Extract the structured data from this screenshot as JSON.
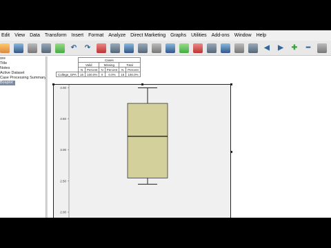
{
  "menu": [
    "Edit",
    "View",
    "Data",
    "Transform",
    "Insert",
    "Format",
    "Analyze",
    "Direct Marketing",
    "Graphs",
    "Utilities",
    "Add-ons",
    "Window",
    "Help"
  ],
  "toolbar_icons": [
    "open-icon",
    "save-icon",
    "print-icon",
    "dialog-recall-icon",
    "refresh-icon",
    "undo-icon",
    "redo-icon",
    "goto-data-icon",
    "goto-case-icon",
    "goto-variable-icon",
    "variables-icon",
    "find-icon",
    "split-file-icon",
    "weight-cases-icon",
    "select-cases-icon",
    "value-labels-icon",
    "use-sets-icon",
    "show-all-icon",
    "designate-window-icon",
    "back-arrow-icon",
    "forward-arrow-icon",
    "expand-plus-icon",
    "collapse-minus-icon",
    "show-icon",
    "hide-icon",
    "insert-heading-icon",
    "insert-title-icon"
  ],
  "outline": {
    "items": [
      {
        "label": "ore",
        "selected": false
      },
      {
        "label": "Title",
        "selected": false
      },
      {
        "label": "Notes",
        "selected": false
      },
      {
        "label": "Active Dataset",
        "selected": false
      },
      {
        "label": "Case Processing Summary",
        "selected": false
      },
      {
        "label": "Boxplot",
        "selected": true
      }
    ]
  },
  "case_table": {
    "header": "Cases",
    "groups": [
      "Valid",
      "Missing",
      "Total"
    ],
    "subheaders": [
      "N",
      "Percent",
      "N",
      "Percent",
      "N",
      "Percent"
    ],
    "row_label": "College_GPA",
    "values": [
      "15",
      "100.0%",
      "0",
      "0.0%",
      "15",
      "100.0%"
    ]
  },
  "chart_data": {
    "type": "box",
    "y_ticks": [
      "4.00",
      "3.50",
      "3.00",
      "2.50",
      "2.00"
    ],
    "ylim": [
      1.9,
      4.05
    ],
    "min": 2.45,
    "q1": 2.55,
    "median": 3.22,
    "q3": 3.75,
    "max": 4.0,
    "box_color": "#d3d09c",
    "background_color": "#f0f0f0"
  }
}
